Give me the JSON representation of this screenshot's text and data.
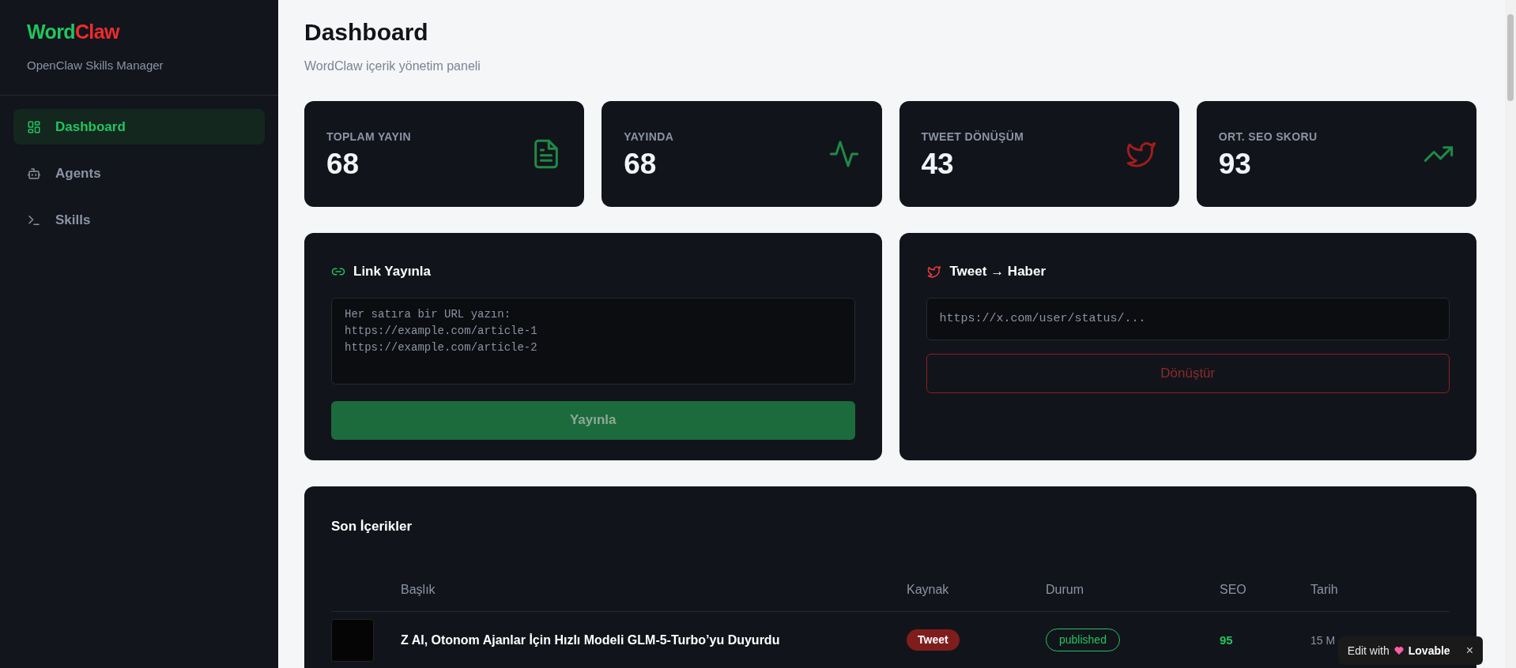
{
  "sidebar": {
    "brand_first": "Word",
    "brand_second": "Claw",
    "subtitle": "OpenClaw Skills Manager",
    "items": [
      {
        "label": "Dashboard",
        "selected": true
      },
      {
        "label": "Agents",
        "selected": false
      },
      {
        "label": "Skills",
        "selected": false
      }
    ]
  },
  "page": {
    "title": "Dashboard",
    "subtitle": "WordClaw içerik yönetim paneli"
  },
  "stats": [
    {
      "label": "TOPLAM YAYIN",
      "value": "68"
    },
    {
      "label": "YAYINDA",
      "value": "68"
    },
    {
      "label": "TWEET DÖNÜŞÜM",
      "value": "43"
    },
    {
      "label": "ORT. SEO SKORU",
      "value": "93"
    }
  ],
  "link_panel": {
    "title": "Link Yayınla",
    "placeholder": "Her satıra bir URL yazın:\nhttps://example.com/article-1\nhttps://example.com/article-2",
    "button": "Yayınla"
  },
  "tweet_panel": {
    "title": "Tweet → Haber",
    "placeholder": "https://x.com/user/status/...",
    "button": "Dönüştür"
  },
  "table": {
    "title": "Son İçerikler",
    "columns": [
      "Başlık",
      "Kaynak",
      "Durum",
      "SEO",
      "Tarih"
    ],
    "rows": [
      {
        "title": "Z AI, Otonom Ajanlar İçin Hızlı Modeli GLM-5-Turbo’yu Duyurdu",
        "source": "Tweet",
        "status": "published",
        "seo": "95",
        "date": "15 M"
      }
    ]
  },
  "overlay": {
    "prefix": "Edit with",
    "brand": "Lovable",
    "close": "×"
  }
}
